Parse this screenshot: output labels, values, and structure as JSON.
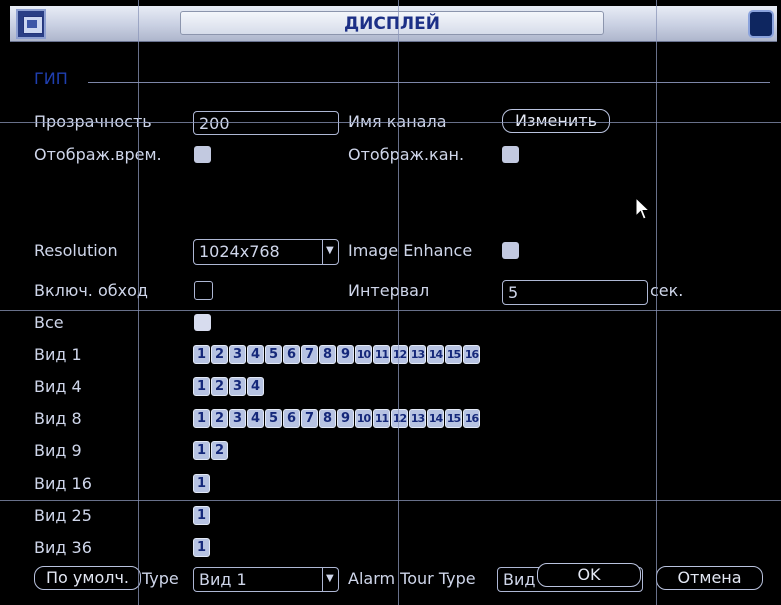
{
  "window": {
    "title": "ДИСПЛЕЙ",
    "icons": {
      "app": "monitor-icon",
      "close": "close-icon"
    }
  },
  "section": {
    "label": "ГИП"
  },
  "rows": {
    "transparency": {
      "label": "Прозрачность",
      "value": "200"
    },
    "channel_name": {
      "label": "Имя канала",
      "button": "Изменить"
    },
    "show_time": {
      "label": "Отображ.врем.",
      "checked": true
    },
    "show_channel": {
      "label": "Отображ.кан.",
      "checked": true
    },
    "resolution": {
      "label": "Resolution",
      "value": "1024x768"
    },
    "image_enhance": {
      "label": "Image Enhance",
      "checked": true
    },
    "tour": {
      "label": "Включ. обход",
      "checked": false
    },
    "interval": {
      "label": "Интервал",
      "value": "5",
      "unit": "сек."
    }
  },
  "views": [
    {
      "label": "Все",
      "channels": []
    },
    {
      "label": "Вид 1",
      "channels": [
        "1",
        "2",
        "3",
        "4",
        "5",
        "6",
        "7",
        "8",
        "9",
        "10",
        "11",
        "12",
        "13",
        "14",
        "15",
        "16"
      ]
    },
    {
      "label": "Вид 4",
      "channels": [
        "1",
        "2",
        "3",
        "4"
      ]
    },
    {
      "label": "Вид 8",
      "channels": [
        "1",
        "2",
        "3",
        "4",
        "5",
        "6",
        "7",
        "8",
        "9",
        "10",
        "11",
        "12",
        "13",
        "14",
        "15",
        "16"
      ]
    },
    {
      "label": "Вид 9",
      "channels": [
        "1",
        "2"
      ]
    },
    {
      "label": "Вид 16",
      "channels": [
        "1"
      ]
    },
    {
      "label": "Вид 25",
      "channels": [
        "1"
      ]
    },
    {
      "label": "Вид 36",
      "channels": [
        "1"
      ]
    }
  ],
  "footer": {
    "default_button": "По умолч.",
    "type_label": "Type",
    "type_value": "Вид 1",
    "alarm_tour_label": "Alarm Tour Type",
    "alarm_tour_value": "Вид",
    "ok_button": "OK",
    "cancel_button": "Отмена"
  }
}
